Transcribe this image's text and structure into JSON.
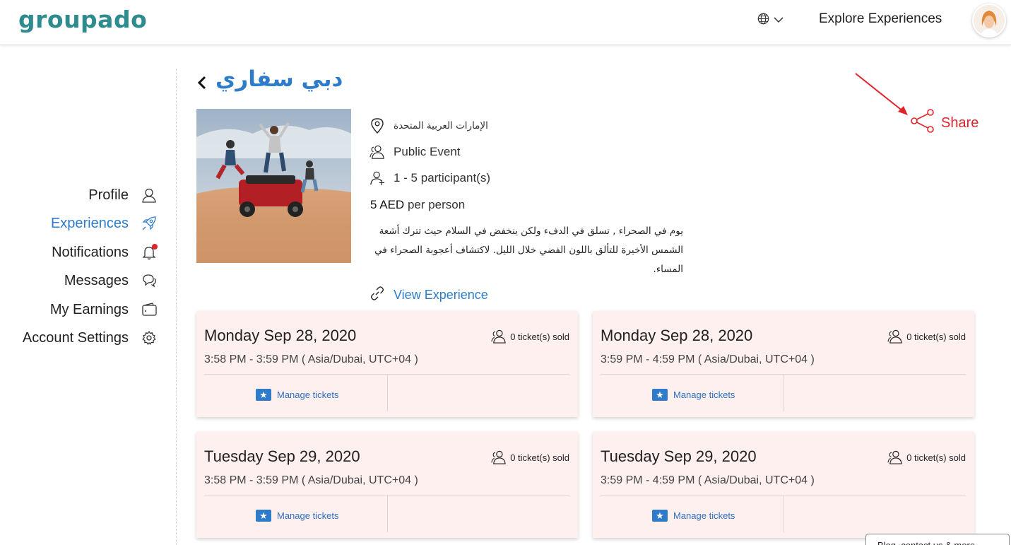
{
  "header": {
    "logo": "groupado",
    "explore_label": "Explore Experiences"
  },
  "sidebar": {
    "items": [
      {
        "label": "Profile",
        "icon": "user-icon"
      },
      {
        "label": "Experiences",
        "icon": "rocket-icon",
        "active": true
      },
      {
        "label": "Notifications",
        "icon": "bell-icon"
      },
      {
        "label": "Messages",
        "icon": "chat-icon"
      },
      {
        "label": "My Earnings",
        "icon": "wallet-icon"
      },
      {
        "label": "Account Settings",
        "icon": "gear-icon"
      }
    ]
  },
  "experience": {
    "title": "دبي سفاري",
    "location": "الإمارات العربية المتحدة",
    "event_type": "Public Event",
    "participants": "1 - 5 participant(s)",
    "price_amount": "5 AED",
    "price_unit": "per person",
    "description": "يوم في الصحراء , تسلق في الدفء ولكن ينخفض في السلام حيث تترك أشعة الشمس الأخيرة للتألق باللون الفضي خلال الليل. لاكتشاف أعجوبة الصحراء في المساء.",
    "view_link": "View Experience",
    "share_label": "Share"
  },
  "sessions": [
    {
      "date": "Monday Sep 28, 2020",
      "time": "3:58 PM - 3:59 PM ( Asia/Dubai, UTC+04 )",
      "sold": "0 ticket(s) sold",
      "manage": "Manage tickets"
    },
    {
      "date": "Monday Sep 28, 2020",
      "time": "3:59 PM - 4:59 PM ( Asia/Dubai, UTC+04 )",
      "sold": "0 ticket(s) sold",
      "manage": "Manage tickets"
    },
    {
      "date": "Tuesday Sep 29, 2020",
      "time": "3:58 PM - 3:59 PM ( Asia/Dubai, UTC+04 )",
      "sold": "0 ticket(s) sold",
      "manage": "Manage tickets"
    },
    {
      "date": "Tuesday Sep 29, 2020",
      "time": "3:59 PM - 4:59 PM ( Asia/Dubai, UTC+04 )",
      "sold": "0 ticket(s) sold",
      "manage": "Manage tickets"
    }
  ],
  "footer": {
    "tab_label": "Blog, contact us & more"
  },
  "colors": {
    "brand": "#2e8c8f",
    "accent": "#2e7cc9",
    "share": "#e0242a",
    "card_bg": "#fdf0ef"
  }
}
